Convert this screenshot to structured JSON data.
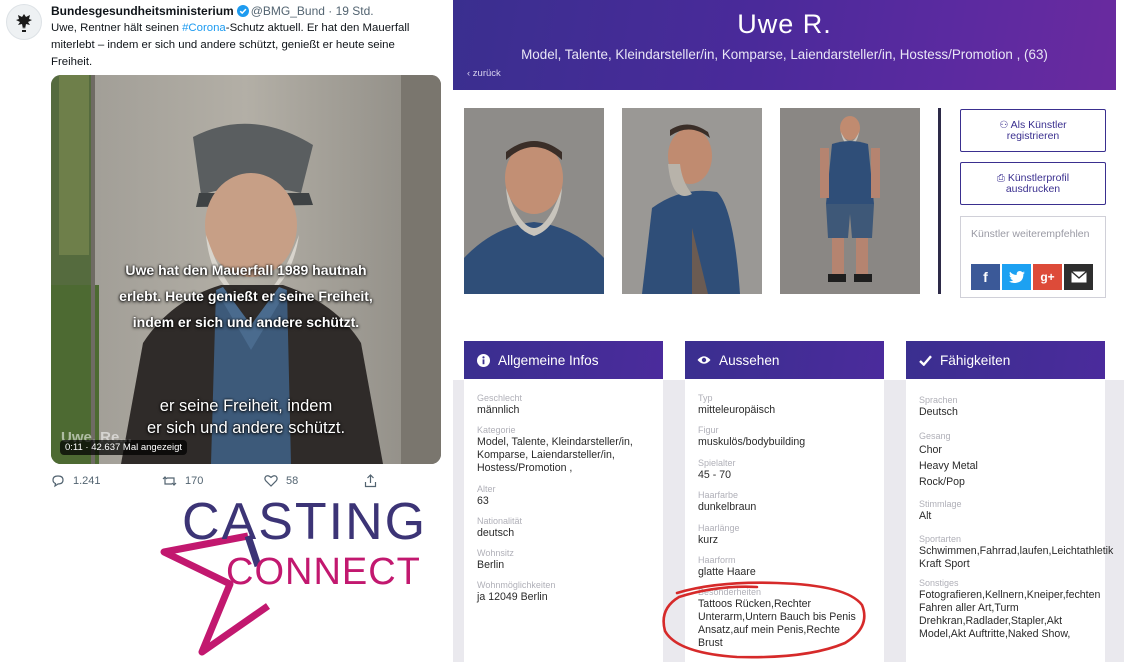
{
  "tweet": {
    "account_name": "Bundesgesundheitsministerium",
    "handle": "@BMG_Bund",
    "time": "· 19 Std.",
    "text_pre": "Uwe, Rentner hält seinen ",
    "hashtag": "#Corona",
    "text_post": "-Schutz aktuell. Er hat den Mauerfall miterlebt – indem er sich und andere schützt, genießt er heute seine Freiheit.",
    "video": {
      "subtitle_big": [
        "Uwe hat den Mauerfall 1989 hautnah",
        "erlebt. Heute genießt er seine Freiheit,",
        "indem er sich und andere schützt."
      ],
      "subtitle_small": [
        "er seine Freiheit, indem",
        "er sich und andere schützt."
      ],
      "watermark": "Uwe, Re...",
      "badge": "0:11 · 42.637 Mal angezeigt"
    },
    "actions": {
      "replies": "1.241",
      "retweets": "170",
      "likes": "58"
    },
    "colors": {
      "link": "#1d9bf0",
      "muted": "#536471"
    }
  },
  "logo": {
    "line1": "CASTING",
    "line2": "CONNECT",
    "colors": {
      "navy": "#3c3476",
      "magenta": "#c2186f"
    }
  },
  "profile": {
    "name": "Uwe R.",
    "categories": "Model, Talente, Kleindarsteller/in, Komparse, Laiendarsteller/in, Hostess/Promotion , (63)",
    "back": "‹  zurück",
    "buttons": {
      "register": [
        "Als Künstler",
        "registrieren"
      ],
      "print": [
        "Künstlerprofil",
        "ausdrucken"
      ]
    },
    "recommend": {
      "label": "Künstler weiterempfehlen",
      "icons": [
        "facebook-icon",
        "twitter-icon",
        "google-plus-icon",
        "email-icon"
      ]
    },
    "panels": {
      "general": {
        "title": "Allgemeine Infos",
        "fields": [
          {
            "label": "Geschlecht",
            "value": "männlich"
          },
          {
            "label": "Kategorie",
            "value": "Model, Talente, Kleindarsteller/in, Komparse, Laiendarsteller/in, Hostess/Promotion ,"
          },
          {
            "label": "Alter",
            "value": "63"
          },
          {
            "label": "Nationalität",
            "value": "deutsch"
          },
          {
            "label": "Wohnsitz",
            "value": "Berlin"
          },
          {
            "label": "Wohnmöglichkeiten",
            "value": "ja 12049 Berlin"
          }
        ]
      },
      "appearance": {
        "title": "Aussehen",
        "fields": [
          {
            "label": "Typ",
            "value": "mitteleuropäisch"
          },
          {
            "label": "Figur",
            "value": "muskulös/bodybuilding"
          },
          {
            "label": "Spielalter",
            "value": "45 - 70"
          },
          {
            "label": "Haarfarbe",
            "value": "dunkelbraun"
          },
          {
            "label": "Haarlänge",
            "value": "kurz"
          },
          {
            "label": "Haarform",
            "value": "glatte Haare"
          },
          {
            "label": "Besonderheiten",
            "value": "Tattoos Rücken,Rechter Unterarm,Untern Bauch bis Penis Ansatz,auf mein Penis,Rechte Brust"
          }
        ]
      },
      "skills": {
        "title": "Fähigkeiten",
        "fields": [
          {
            "label": "Sprachen",
            "value": "Deutsch"
          },
          {
            "label": "Gesang",
            "lines": [
              "Chor",
              "Heavy Metal",
              "Rock/Pop"
            ]
          },
          {
            "label": "Stimmlage",
            "value": "Alt"
          },
          {
            "label": "Sportarten",
            "lines": [
              "Schwimmen,Fahrrad,laufen,Leichtathletik",
              "Kraft Sport"
            ]
          },
          {
            "label": "Sonstiges",
            "lines": [
              "Fotografieren,Kellnern,Kneiper,fechten",
              "Fahren aller Art,Turm",
              "Drehkran,Radlader,Stapler,Akt",
              "Model,Akt Auftritte,Naked Show,"
            ]
          }
        ]
      }
    },
    "colors": {
      "header": "#3a2f8f",
      "panel_band": "#eae9ee",
      "annotation": "#d62a2a"
    }
  }
}
